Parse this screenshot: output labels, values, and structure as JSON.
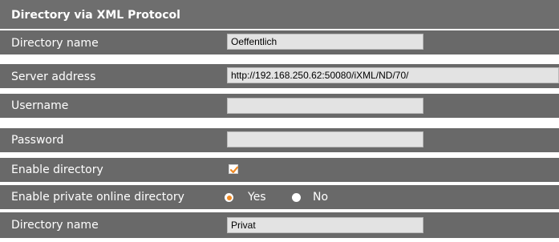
{
  "section": {
    "title": "Directory via XML Protocol"
  },
  "fields": {
    "directory_name": {
      "label": "Directory name",
      "value": "Oeffentlich"
    },
    "server_address": {
      "label": "Server address",
      "value": "http://192.168.250.62:50080/iXML/ND/70/"
    },
    "username": {
      "label": "Username",
      "value": ""
    },
    "password": {
      "label": "Password",
      "value": ""
    },
    "enable_directory": {
      "label": "Enable directory",
      "checked": true
    },
    "enable_private": {
      "label": "Enable private online directory",
      "options": [
        "Yes",
        "No"
      ],
      "selected": "Yes"
    },
    "private_directory_name": {
      "label": "Directory name",
      "value": "Privat"
    }
  },
  "colors": {
    "accent": "#f08a24",
    "panel": "#696969",
    "field": "#e3e3e3"
  }
}
